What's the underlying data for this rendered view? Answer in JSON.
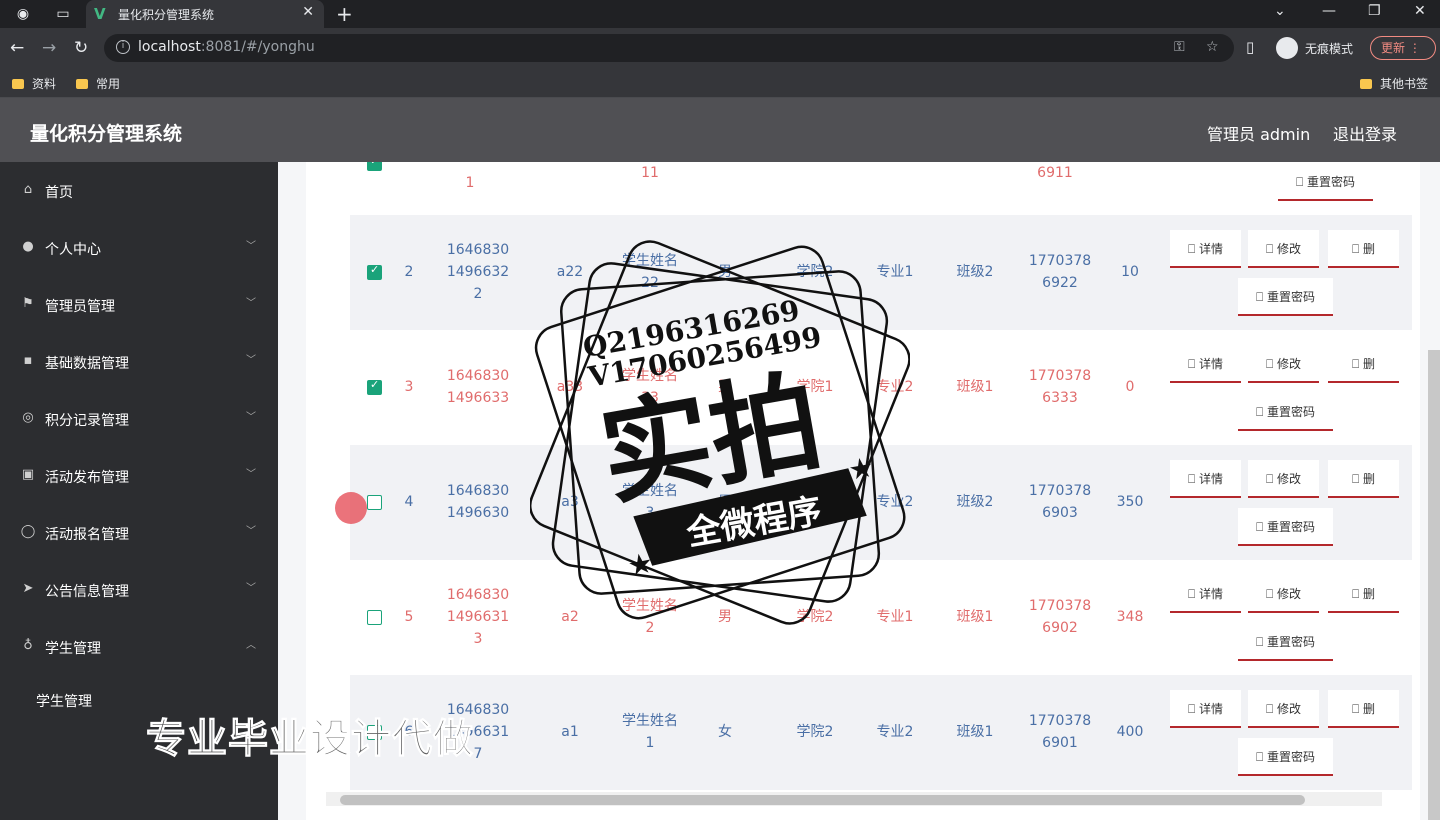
{
  "browser": {
    "tab_title": "量化积分管理系统",
    "url_host": "localhost",
    "url_rest": ":8081/#/yonghu",
    "incognito_label": "无痕模式",
    "update_label": "更新",
    "bookmarks": [
      "资料",
      "常用"
    ],
    "other_bookmarks": "其他书签"
  },
  "header": {
    "title": "量化积分管理系统",
    "user": "管理员 admin",
    "logout": "退出登录"
  },
  "sidebar": {
    "items": [
      {
        "label": "首页",
        "icon": "home-icon"
      },
      {
        "label": "个人中心",
        "icon": "user-icon"
      },
      {
        "label": "管理员管理",
        "icon": "flag-icon"
      },
      {
        "label": "基础数据管理",
        "icon": "chat-icon"
      },
      {
        "label": "积分记录管理",
        "icon": "compass-icon"
      },
      {
        "label": "活动发布管理",
        "icon": "document-icon"
      },
      {
        "label": "活动报名管理",
        "icon": "circle-icon"
      },
      {
        "label": "公告信息管理",
        "icon": "send-icon"
      },
      {
        "label": "学生管理",
        "icon": "mic-icon"
      }
    ],
    "sub_item": "学生管理"
  },
  "table": {
    "top_partial": {
      "account": "1",
      "name": "11",
      "phone": "6911"
    },
    "rows": [
      {
        "checked": true,
        "idx": "2",
        "account": [
          "1646830",
          "1496632",
          "2"
        ],
        "user": "a22",
        "name": [
          "学生姓名",
          "22"
        ],
        "gender": "男",
        "college": "学院2",
        "major": "专业1",
        "class": "班级2",
        "phone": [
          "1770378",
          "6922"
        ],
        "points": "10",
        "color": "#4a6fa5"
      },
      {
        "checked": true,
        "idx": "3",
        "account": [
          "1646830",
          "1496633"
        ],
        "user": "a33",
        "name": [
          "学生姓名",
          "33"
        ],
        "gender": "男",
        "college": "学院1",
        "major": "专业2",
        "class": "班级1",
        "phone": [
          "1770378",
          "6333"
        ],
        "points": "0",
        "color": "#e06c6c"
      },
      {
        "checked": false,
        "idx": "4",
        "account": [
          "1646830",
          "1496630"
        ],
        "user": "a3",
        "name": [
          "学生姓名",
          "3"
        ],
        "gender": "男",
        "college": "学院1",
        "major": "专业2",
        "class": "班级2",
        "phone": [
          "1770378",
          "6903"
        ],
        "points": "350",
        "color": "#4a6fa5"
      },
      {
        "checked": false,
        "idx": "5",
        "account": [
          "1646830",
          "1496631",
          "3"
        ],
        "user": "a2",
        "name": [
          "学生姓名",
          "2"
        ],
        "gender": "男",
        "college": "学院2",
        "major": "专业1",
        "class": "班级1",
        "phone": [
          "1770378",
          "6902"
        ],
        "points": "348",
        "color": "#e06c6c"
      },
      {
        "checked": false,
        "idx": "6",
        "account": [
          "1646830",
          "1496631",
          "7"
        ],
        "user": "a1",
        "name": [
          "学生姓名",
          "1"
        ],
        "gender": "女",
        "college": "学院2",
        "major": "专业2",
        "class": "班级1",
        "phone": [
          "1770378",
          "6901"
        ],
        "points": "400",
        "color": "#4a6fa5"
      }
    ],
    "actions": {
      "detail": "详情",
      "edit": "修改",
      "delete": "删",
      "reset": "重置密码"
    }
  },
  "overlays": {
    "stamp_lines": [
      "Q2196316269",
      "V17060256499"
    ],
    "stamp_big": "实拍",
    "stamp_banner": "全微程序",
    "watermark": "专业毕业设计代做"
  }
}
